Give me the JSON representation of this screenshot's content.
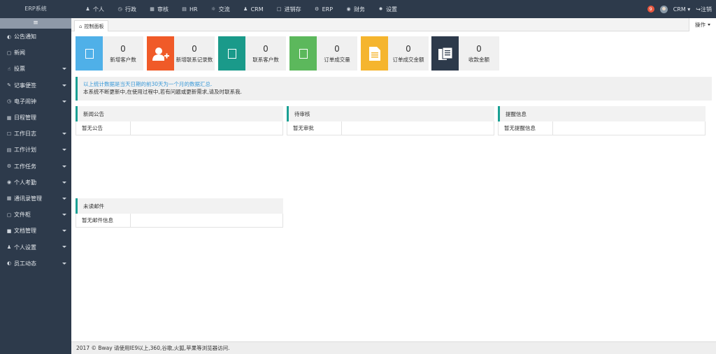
{
  "brand": "ERP系统",
  "topnav": [
    {
      "label": "个人",
      "icon": "user-icon"
    },
    {
      "label": "行政",
      "icon": "clock-icon"
    },
    {
      "label": "审核",
      "icon": "calendar-icon"
    },
    {
      "label": "HR",
      "icon": "hr-icon"
    },
    {
      "label": "交流",
      "icon": "chat-icon"
    },
    {
      "label": "CRM",
      "icon": "users-icon"
    },
    {
      "label": "进销存",
      "icon": "folder-icon"
    },
    {
      "label": "ERP",
      "icon": "erp-icon"
    },
    {
      "label": "财务",
      "icon": "finance-icon"
    },
    {
      "label": "设置",
      "icon": "gear-icon"
    }
  ],
  "topright": {
    "notif_count": "9",
    "crm_label": "CRM",
    "logout_label": "注销"
  },
  "sidebar": {
    "toggle": "≡",
    "items": [
      {
        "label": "公告通知",
        "icon": "notice-icon",
        "caret": false
      },
      {
        "label": "新闻",
        "icon": "news-icon",
        "caret": false
      },
      {
        "label": "投票",
        "icon": "vote-icon",
        "caret": true
      },
      {
        "label": "记事便签",
        "icon": "note-icon",
        "caret": true
      },
      {
        "label": "电子闹钟",
        "icon": "alarm-icon",
        "caret": true
      },
      {
        "label": "日程管理",
        "icon": "schedule-icon",
        "caret": false
      },
      {
        "label": "工作日志",
        "icon": "log-icon",
        "caret": true
      },
      {
        "label": "工作计划",
        "icon": "plan-icon",
        "caret": true
      },
      {
        "label": "工作任务",
        "icon": "task-icon",
        "caret": true
      },
      {
        "label": "个人考勤",
        "icon": "attendance-icon",
        "caret": true
      },
      {
        "label": "通讯录管理",
        "icon": "contacts-icon",
        "caret": true
      },
      {
        "label": "文件柜",
        "icon": "cabinet-icon",
        "caret": true
      },
      {
        "label": "文档管理",
        "icon": "docs-icon",
        "caret": true
      },
      {
        "label": "个人设置",
        "icon": "user-settings-icon",
        "caret": true
      },
      {
        "label": "员工动态",
        "icon": "staff-icon",
        "caret": true
      }
    ]
  },
  "tabs": {
    "dashboard_label": "控制面板",
    "op_label": "操作"
  },
  "stats": [
    {
      "value": "0",
      "label": "新增客户数",
      "color": "#4fb0e8",
      "icon": "customer-icon"
    },
    {
      "value": "0",
      "label": "新增联系记录数",
      "color": "#f05a28",
      "icon": "add-user-icon"
    },
    {
      "value": "0",
      "label": "联系客户数",
      "color": "#1a9a8a",
      "icon": "contact-icon"
    },
    {
      "value": "0",
      "label": "订单成交量",
      "color": "#5cb85c",
      "icon": "order-icon"
    },
    {
      "value": "0",
      "label": "订单成交金额",
      "color": "#f5b52e",
      "icon": "document-icon"
    },
    {
      "value": "0",
      "label": "收款金额",
      "color": "#2d3a4b",
      "icon": "files-icon"
    }
  ],
  "notice": {
    "line1": "以上统计数据是当天日期的前30天为一个月的数据汇总.",
    "line2": "本系统不断更新中,在使用过程中,若有问题或更新需求,请及时联系我."
  },
  "panels": {
    "news": {
      "title": "新闻公告",
      "empty": "暂无公告"
    },
    "pending": {
      "title": "待审核",
      "empty": "暂无审批"
    },
    "reminder": {
      "title": "提醒信息",
      "empty": "暂无提醒信息"
    },
    "mail": {
      "title": "未读邮件",
      "empty": "暂无邮件信息"
    }
  },
  "footer": "2017 © Bway 请使用IE9以上,360,谷歌,火狐,苹果等浏览器访问."
}
